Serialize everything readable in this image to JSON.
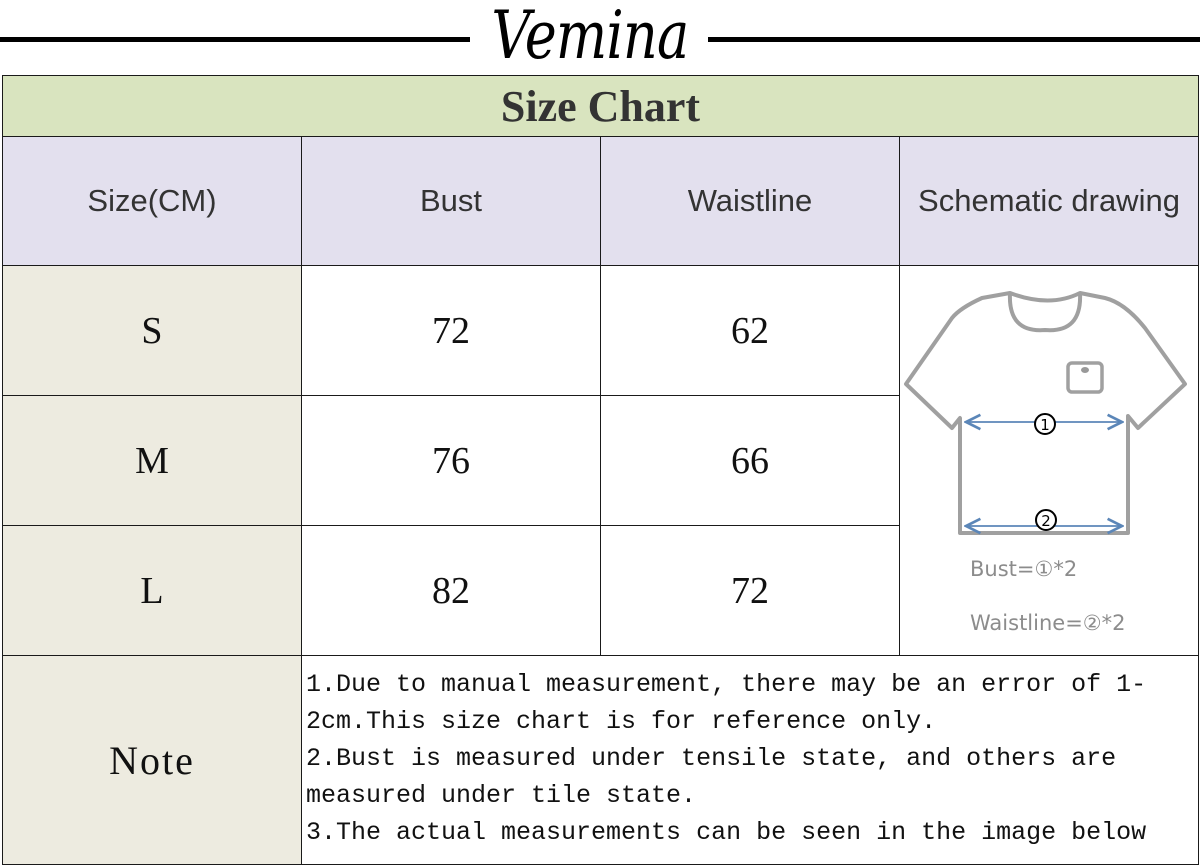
{
  "brand": {
    "name": "Vemina"
  },
  "chart": {
    "title": "Size Chart",
    "headers": [
      "Size(CM)",
      "Bust",
      "Waistline",
      "Schematic drawing"
    ],
    "rows": [
      {
        "size": "S",
        "bust": "72",
        "waistline": "62"
      },
      {
        "size": "M",
        "bust": "76",
        "waistline": "66"
      },
      {
        "size": "L",
        "bust": "82",
        "waistline": "72"
      }
    ],
    "schematic": {
      "marker_1": "1",
      "marker_2": "2",
      "bust_formula": "Bust=①*2",
      "waistline_formula": "Waistline=②*2",
      "arrow_color": "#5b86b8",
      "outline_color": "#a0a0a0"
    },
    "note": {
      "label": "Note",
      "lines": [
        "1.Due to manual measurement, there may be an error of 1-",
        "2cm.This size chart is for reference only.",
        "2.Bust is measured under tensile state, and others are",
        "measured under tile state.",
        "3.The actual measurements can be seen in the image below"
      ]
    }
  }
}
